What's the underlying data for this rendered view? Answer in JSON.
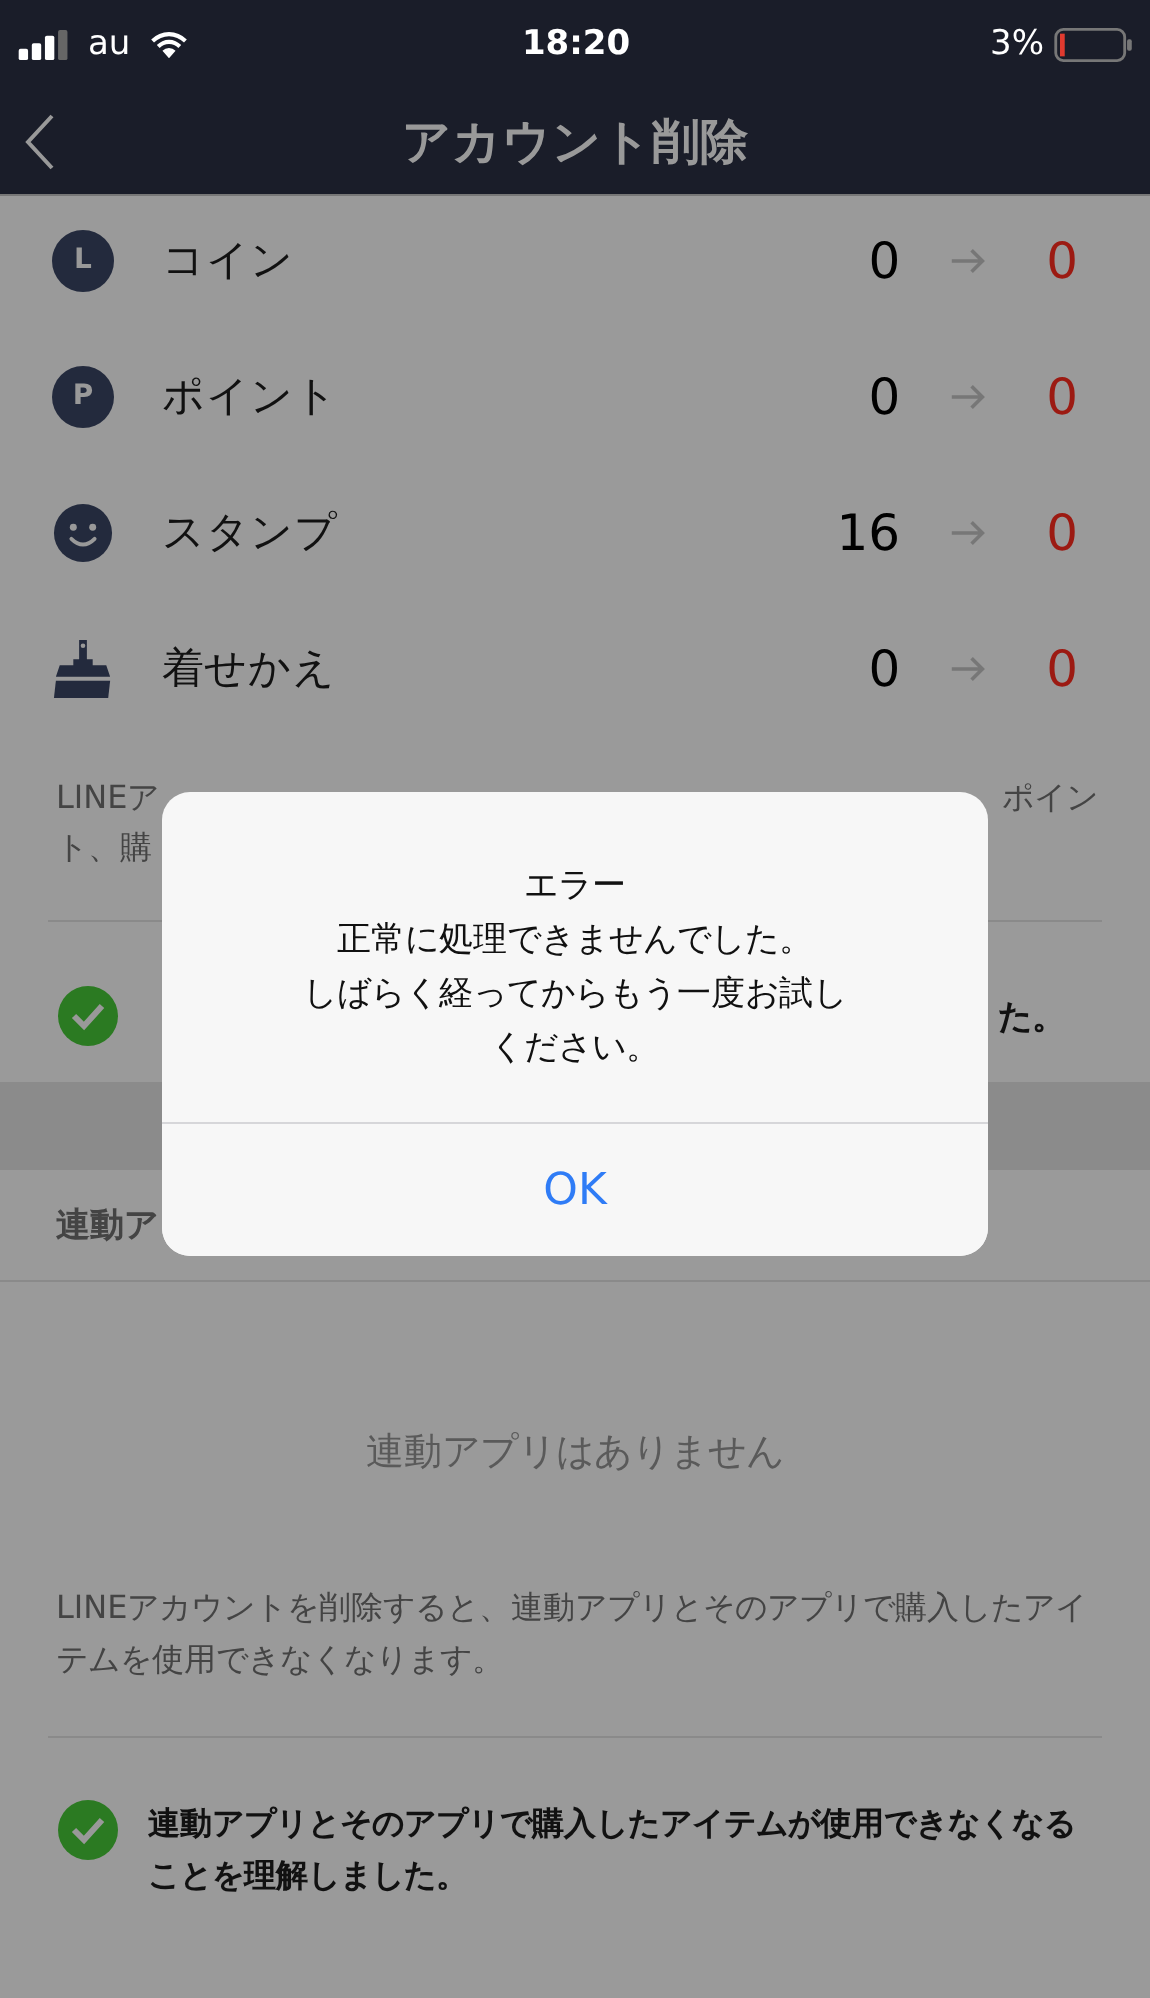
{
  "status_bar": {
    "carrier": "au",
    "time": "18:20",
    "battery": "3%"
  },
  "nav": {
    "title": "アカウント削除"
  },
  "items": [
    {
      "kind": "letter",
      "icon_text": "L",
      "label": "コイン",
      "current": "0",
      "after": "0"
    },
    {
      "kind": "letter",
      "icon_text": "P",
      "label": "ポイント",
      "current": "0",
      "after": "0"
    },
    {
      "kind": "smile",
      "label": "スタンプ",
      "current": "16",
      "after": "0"
    },
    {
      "kind": "brush",
      "label": "着せかえ",
      "current": "0",
      "after": "0"
    }
  ],
  "notice_1": {
    "line_1_left": "LINEア",
    "line_1_right": "ポイン",
    "line_2": "ト、購"
  },
  "confirm_1": {
    "checked": true,
    "text": "た。"
  },
  "section_header": "連動ア",
  "empty_text": "連動アプリはありません",
  "notice_2": "LINEアカウントを削除すると、連動アプリとそのアプリで購入したアイテムを使用できなくなります。",
  "confirm_2": {
    "checked": true,
    "text": "連動アプリとそのアプリで購入したアイテムが使用できなくなることを理解しました。"
  },
  "dialog": {
    "title": "エラー",
    "message_lines": [
      "正常に処理できませんでした。",
      "しばらく経ってからもう一度お試し",
      "ください。"
    ],
    "button": "OK"
  }
}
